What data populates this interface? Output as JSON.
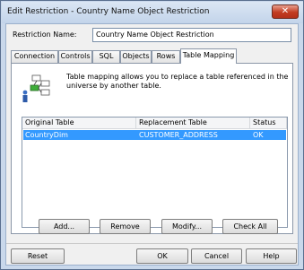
{
  "window": {
    "title": "Edit Restriction - Country Name Object Restriction",
    "close_symbol": "✕"
  },
  "restriction_name": {
    "label": "Restriction Name:",
    "value": "Country Name Object Restriction"
  },
  "tabs": [
    {
      "label": "Connection",
      "active": false
    },
    {
      "label": "Controls",
      "active": false
    },
    {
      "label": "SQL",
      "active": false
    },
    {
      "label": "Objects",
      "active": false
    },
    {
      "label": "Rows",
      "active": false
    },
    {
      "label": "Table Mapping",
      "active": true
    }
  ],
  "table_mapping": {
    "description": "Table mapping allows you to replace a table referenced in the universe by another table.",
    "columns": [
      "Original Table",
      "Replacement Table",
      "Status"
    ],
    "rows": [
      {
        "original": "CountryDim",
        "replacement": "CUSTOMER_ADDRESS",
        "status": "OK",
        "selected": true
      }
    ],
    "buttons": {
      "add": "Add...",
      "remove": "Remove",
      "modify": "Modify...",
      "check_all": "Check All"
    }
  },
  "footer": {
    "reset": "Reset",
    "ok": "OK",
    "cancel": "Cancel",
    "help": "Help"
  },
  "colors": {
    "selection": "#3399ff",
    "close_button": "#c23b21"
  }
}
